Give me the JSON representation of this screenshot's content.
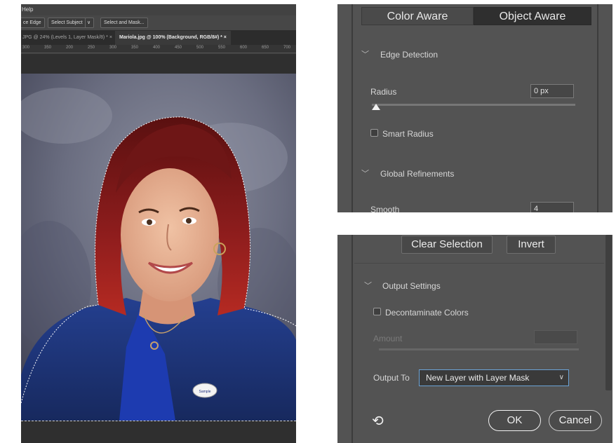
{
  "photoshop": {
    "menu": {
      "help": "Help"
    },
    "options_bar": {
      "refine_edge_partial": "ce Edge",
      "select_subject": "Select Subject",
      "select_and_mask": "Select and Mask..."
    },
    "tabs": [
      {
        "label": "JPG @ 24% (Levels 1, Layer Mask/8) * ×",
        "active": false
      },
      {
        "label": "Mariola.jpg @ 100% (Background, RGB/8#) * ×",
        "active": true
      }
    ],
    "ruler": [
      "300",
      "350",
      "200",
      "250",
      "300",
      "350",
      "400",
      "450",
      "500",
      "550",
      "600",
      "650",
      "700"
    ],
    "photo_description": "portrait",
    "button_badge": "Sample Badge"
  },
  "panel_top": {
    "mode_tabs": [
      "Color Aware",
      "Object Aware"
    ],
    "edge_detection": {
      "heading": "Edge Detection",
      "radius_label": "Radius",
      "radius_value": "0 px",
      "smart_radius_label": "Smart Radius",
      "smart_radius_checked": false
    },
    "global_refinements": {
      "heading": "Global Refinements",
      "smooth_label": "Smooth",
      "smooth_value": "4"
    }
  },
  "panel_bottom": {
    "buttons": {
      "clear_selection": "Clear Selection",
      "invert": "Invert"
    },
    "output_settings": {
      "heading": "Output Settings",
      "decontaminate_label": "Decontaminate Colors",
      "decontaminate_checked": false,
      "amount_label": "Amount",
      "output_to_label": "Output To",
      "output_to_value": "New Layer with Layer Mask"
    },
    "footer": {
      "ok": "OK",
      "cancel": "Cancel"
    }
  },
  "colors": {
    "panel_bg": "#535353",
    "workspace_bg": "#2f2f2f",
    "accent_select_border": "#6ba3d6",
    "hair": "#8f1d1d",
    "cardigan": "#1e3a8a"
  }
}
